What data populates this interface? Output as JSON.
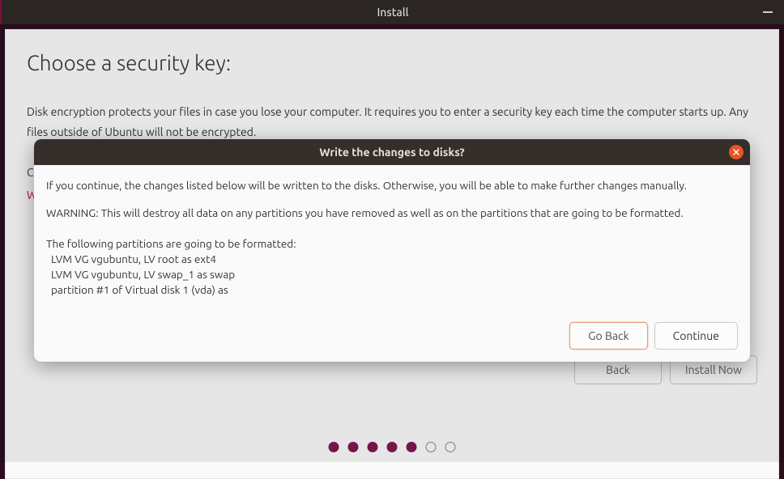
{
  "window": {
    "title": "Install"
  },
  "page": {
    "heading": "Choose a security key:",
    "description": "Disk encryption protects your files in case you lose your computer. It requires you to enter a security key each time the computer starts up. Any files outside of Ubuntu will not be encrypted.",
    "bg_row1_prefix": "Co",
    "bg_row2_prefix": "Wa",
    "back_label": "Back",
    "install_label": "Install Now"
  },
  "progress": {
    "total": 7,
    "current": 5
  },
  "modal": {
    "title": "Write the changes to disks?",
    "intro": "If you continue, the changes listed below will be written to the disks. Otherwise, you will be able to make further changes manually.",
    "warning": "WARNING: This will destroy all data on any partitions you have removed as well as on the partitions that are going to be formatted.",
    "list_heading": "The following partitions are going to be formatted:",
    "items": [
      "LVM VG vgubuntu, LV root as ext4",
      "LVM VG vgubuntu, LV swap_1 as swap",
      "partition #1 of Virtual disk 1 (vda) as"
    ],
    "go_back_label": "Go Back",
    "continue_label": "Continue"
  }
}
